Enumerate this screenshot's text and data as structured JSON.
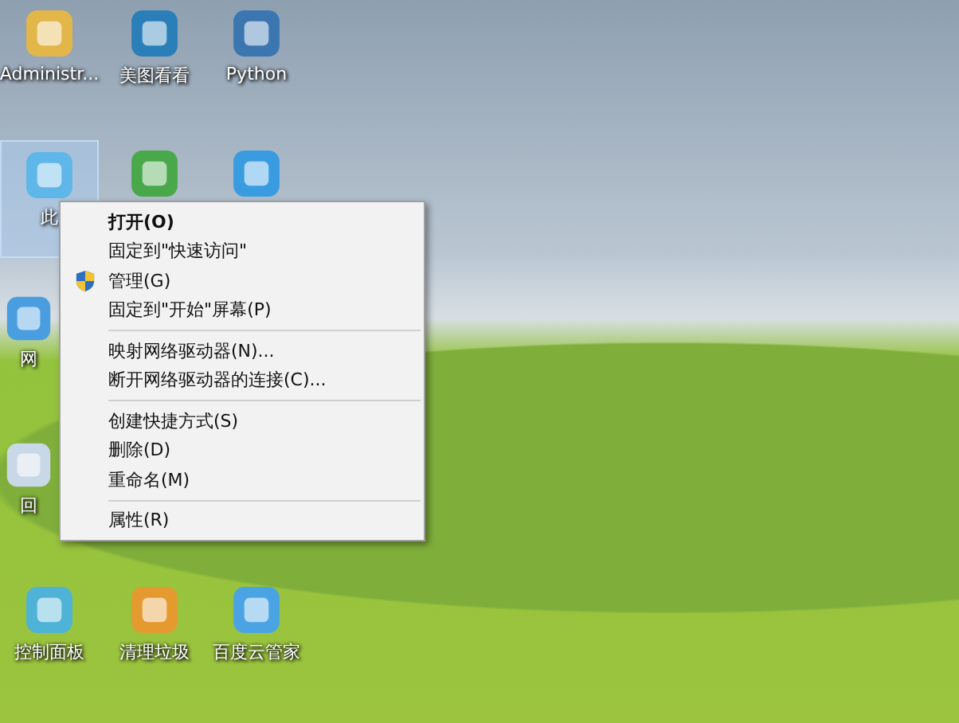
{
  "desktop_icons": [
    {
      "label": "Administr...",
      "selected": false
    },
    {
      "label": "美图看看",
      "selected": false
    },
    {
      "label": "Python",
      "selected": false
    },
    {
      "label": "此",
      "selected": true
    },
    {
      "selected": false
    },
    {
      "selected": false
    },
    {
      "label": "网",
      "selected": false
    },
    {
      "label": "回",
      "selected": false
    },
    {
      "label": "控制面板",
      "selected": false
    },
    {
      "label": "清理垃圾",
      "selected": false
    },
    {
      "label": "百度云管家",
      "selected": false
    }
  ],
  "context_menu": {
    "items": [
      {
        "kind": "item",
        "label": "打开(O)",
        "default": true,
        "shield": false
      },
      {
        "kind": "item",
        "label": "固定到\"快速访问\"",
        "default": false,
        "shield": false
      },
      {
        "kind": "item",
        "label": "管理(G)",
        "default": false,
        "shield": true
      },
      {
        "kind": "item",
        "label": "固定到\"开始\"屏幕(P)",
        "default": false,
        "shield": false
      },
      {
        "kind": "separator"
      },
      {
        "kind": "item",
        "label": "映射网络驱动器(N)...",
        "default": false,
        "shield": false
      },
      {
        "kind": "item",
        "label": "断开网络驱动器的连接(C)...",
        "default": false,
        "shield": false
      },
      {
        "kind": "separator"
      },
      {
        "kind": "item",
        "label": "创建快捷方式(S)",
        "default": false,
        "shield": false
      },
      {
        "kind": "item",
        "label": "删除(D)",
        "default": false,
        "shield": false
      },
      {
        "kind": "item",
        "label": "重命名(M)",
        "default": false,
        "shield": false
      },
      {
        "kind": "separator"
      },
      {
        "kind": "item",
        "label": "属性(R)",
        "default": false,
        "shield": false
      }
    ]
  }
}
